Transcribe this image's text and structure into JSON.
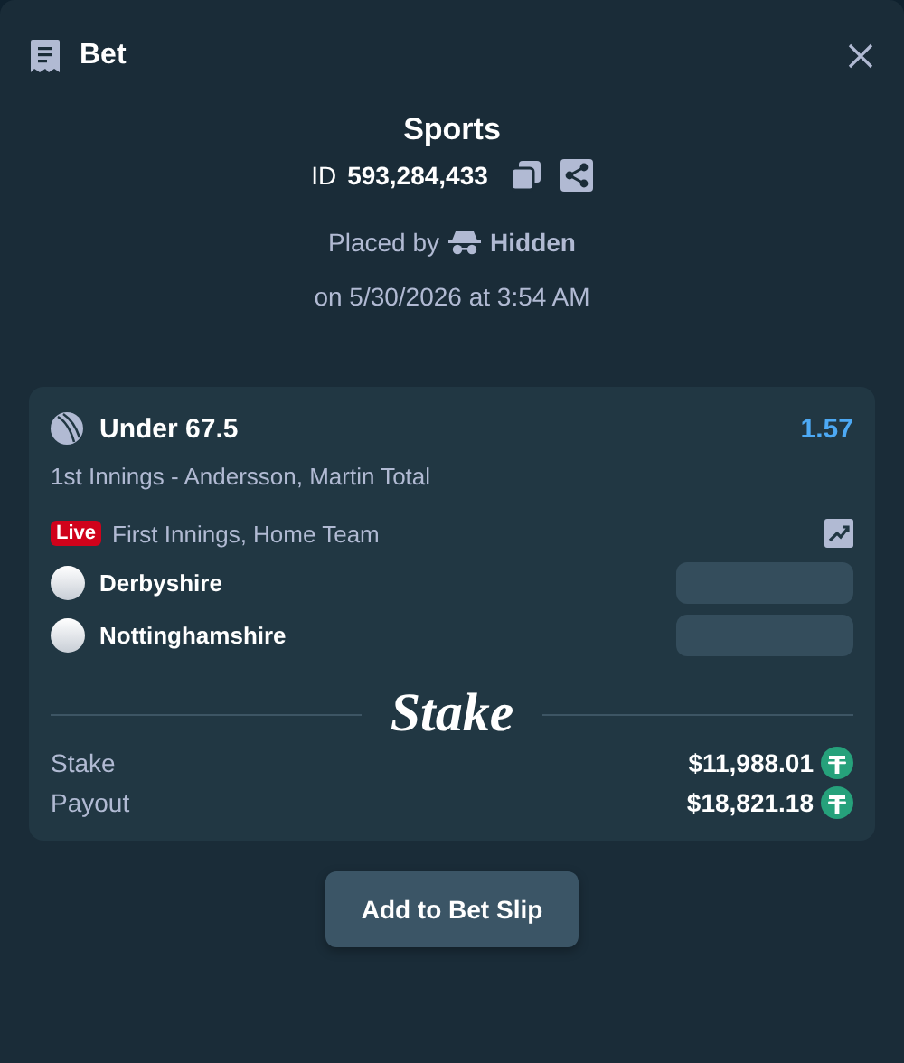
{
  "header": {
    "title": "Bet"
  },
  "sport": "Sports",
  "bet_id": {
    "label": "ID",
    "value": "593,284,433"
  },
  "placed_by": {
    "label": "Placed by",
    "user": "Hidden"
  },
  "placed_at": "on 5/30/2026 at 3:54 AM",
  "selection": {
    "outcome": "Under 67.5",
    "odds": "1.57",
    "market": "1st Innings - Andersson, Martin Total",
    "live_badge": "Live",
    "event": "First Innings, Home Team",
    "teams": [
      {
        "name": "Derbyshire"
      },
      {
        "name": "Nottinghamshire"
      }
    ]
  },
  "brand": "Stake",
  "totals": [
    {
      "label": "Stake",
      "amount": "$11,988.01"
    },
    {
      "label": "Payout",
      "amount": "$18,821.18"
    }
  ],
  "button": "Add to Bet Slip"
}
